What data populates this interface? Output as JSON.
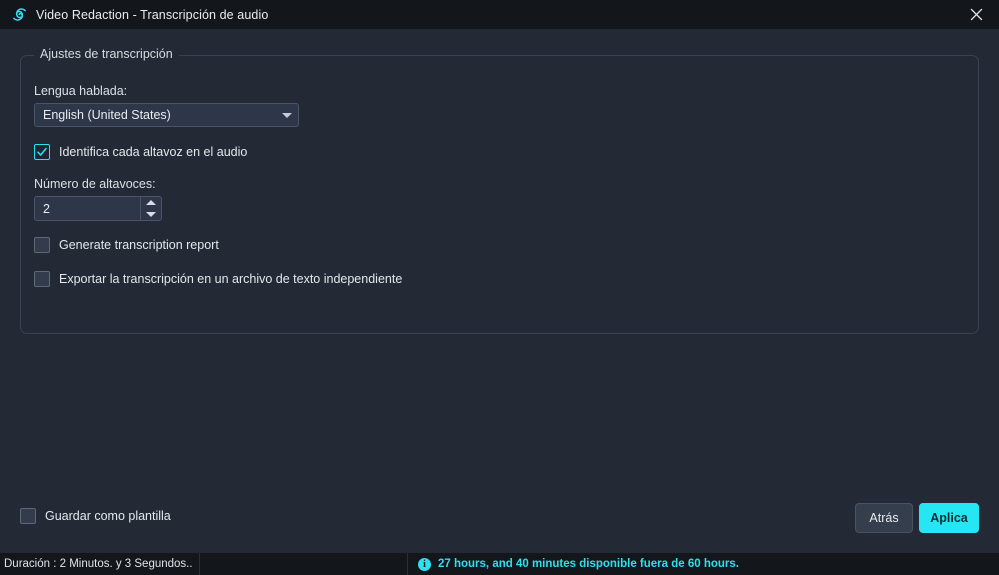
{
  "titlebar": {
    "logo_icon": "spiral-logo-icon",
    "title": "Video Redaction - Transcripción de audio",
    "close_icon": "close-icon"
  },
  "group": {
    "title": "Ajustes de transcripción",
    "language": {
      "label": "Lengua hablada:",
      "value": "English (United States)",
      "arrow_icon": "chevron-down-icon"
    },
    "identify_speaker": {
      "label": "Identifica cada altavoz en el audio",
      "checked": true
    },
    "speaker_count": {
      "label": "Número de altavoces:",
      "value": "2",
      "up_icon": "spinner-up-icon",
      "down_icon": "spinner-down-icon"
    },
    "generate_report": {
      "label": "Generate transcription report",
      "checked": false
    },
    "export_transcript": {
      "label": "Exportar la transcripción en un archivo de texto independiente",
      "checked": false
    }
  },
  "footer": {
    "save_template": {
      "label": "Guardar como plantilla",
      "checked": false
    },
    "back_label": "Atrás",
    "apply_label": "Aplica"
  },
  "statusbar": {
    "duration": "Duración : 2 Minutos. y 3 Segundos..",
    "info_icon": "info-icon",
    "quota": "27 hours, and 40 minutes disponible fuera de 60 hours."
  },
  "colors": {
    "accent": "#25e6f2",
    "titlebar_bg": "#13161a",
    "body_bg": "#232a35",
    "field_bg": "#2d3749"
  }
}
